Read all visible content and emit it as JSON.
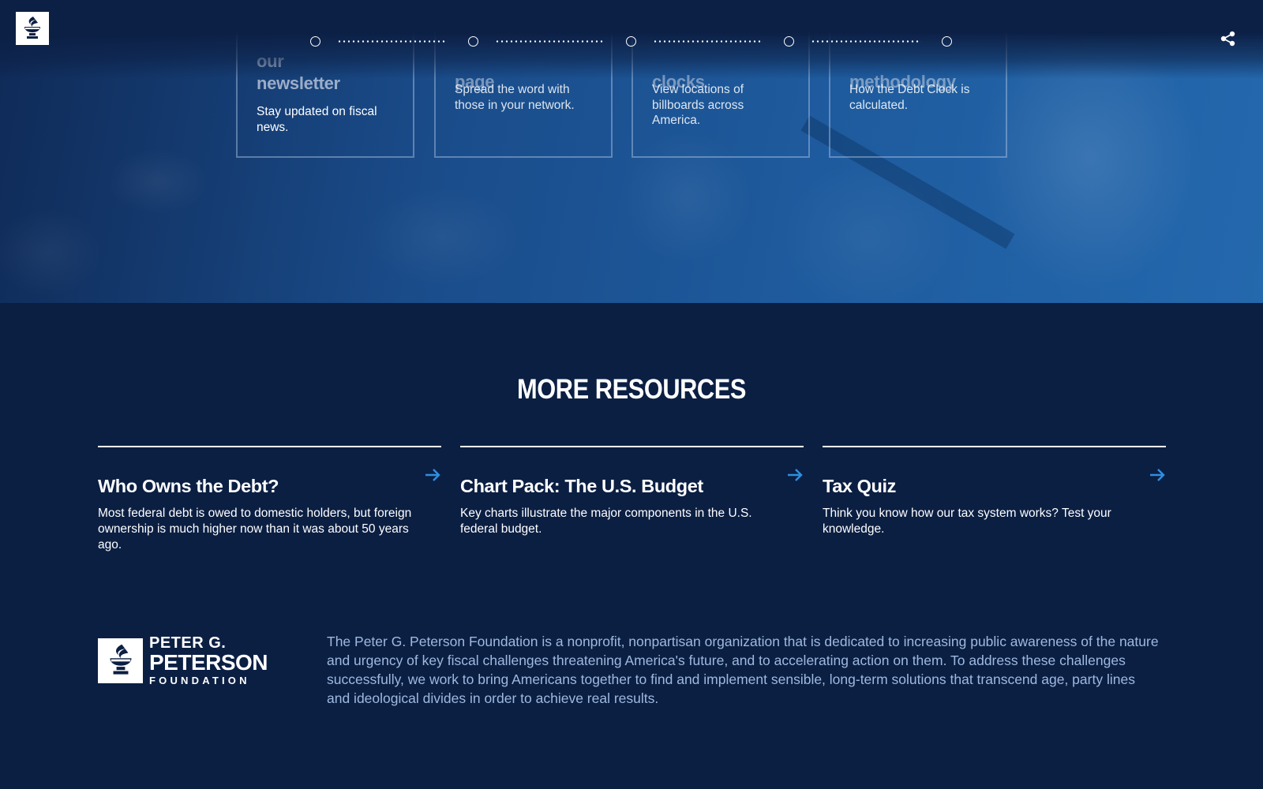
{
  "hero": {
    "cards": [
      {
        "title_lines": [
          "our",
          "newsletter"
        ],
        "description": "Stay updated on fiscal news."
      },
      {
        "title_lines": [
          "page"
        ],
        "description": "Spread the word with those in your network."
      },
      {
        "title_lines": [
          "clocks"
        ],
        "description": "View locations of billboards across America."
      },
      {
        "title_lines": [
          "methodology"
        ],
        "description": "How the Debt Clock is calculated."
      }
    ],
    "track_steps": 5
  },
  "icons": {
    "logo": "torch-logo-icon",
    "share": "share-icon",
    "arrow": "arrow-right-icon"
  },
  "colors": {
    "background": "#0b1f43",
    "accent": "#2f8fe0",
    "footer_text": "#9fb9df"
  },
  "resources": {
    "title": "MORE RESOURCES",
    "items": [
      {
        "title": "Who Owns the Debt?",
        "description": "Most federal debt is owed to domestic holders, but foreign ownership is much higher now than it was about 50 years ago."
      },
      {
        "title": "Chart Pack: The U.S. Budget",
        "description": "Key charts illustrate the major components in the U.S. federal budget."
      },
      {
        "title": "Tax Quiz",
        "description": "Think you know how our tax system works? Test your knowledge."
      }
    ]
  },
  "footer": {
    "logo_line1": "PETER G.",
    "logo_line2": "PETERSON",
    "logo_line3": "FOUNDATION",
    "about": "The Peter G. Peterson Foundation is a nonprofit, nonpartisan organization that is dedicated to increasing public awareness of the nature and urgency of key fiscal challenges threatening America's future, and to accelerating action on them. To address these challenges successfully, we work to bring Americans together to find and implement sensible, long-term solutions that transcend age, party lines and ideological divides in order to achieve real results."
  }
}
